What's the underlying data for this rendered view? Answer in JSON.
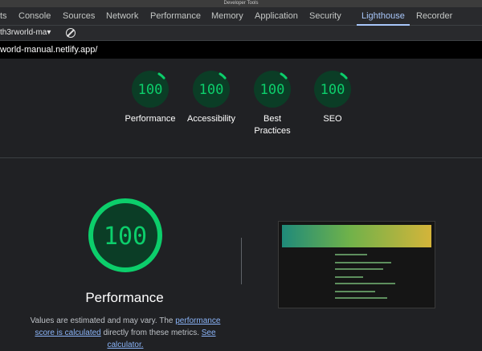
{
  "window": {
    "title": "Developer Tools"
  },
  "tabs": [
    {
      "label": "Elements",
      "visible": "ts"
    },
    {
      "label": "Console"
    },
    {
      "label": "Sources"
    },
    {
      "label": "Network"
    },
    {
      "label": "Performance"
    },
    {
      "label": "Memory"
    },
    {
      "label": "Application"
    },
    {
      "label": "Security"
    },
    {
      "label": "Lighthouse",
      "active": true
    },
    {
      "label": "Recorder"
    }
  ],
  "toolbar": {
    "report_label": "th3rworld-ma▾"
  },
  "url": "world-manual.netlify.app/",
  "scores": [
    {
      "value": "100",
      "label": "Performance",
      "fraction": 1.0
    },
    {
      "value": "100",
      "label": "Accessibility",
      "fraction": 1.0
    },
    {
      "value": "100",
      "label": "Best Practices",
      "fraction": 1.0
    },
    {
      "value": "100",
      "label": "SEO",
      "fraction": 1.0
    }
  ],
  "performance": {
    "score": "100",
    "title": "Performance",
    "note_prefix": "Values are estimated and may vary. The ",
    "link1": "performance score is calculated",
    "note_middle": " directly from these metrics. ",
    "link2": "See calculator."
  },
  "colors": {
    "pass": "#0cce6b",
    "pass_bg": "#0b3d26",
    "link": "#8ab4f8",
    "accent_tab": "#a8c7fa"
  },
  "icons": {
    "clear": "clear-icon"
  }
}
